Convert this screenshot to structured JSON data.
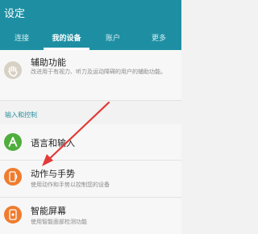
{
  "header": {
    "title": "设定"
  },
  "tabs": [
    {
      "label": "连接"
    },
    {
      "label": "我的设备"
    },
    {
      "label": "账户"
    },
    {
      "label": "更多"
    }
  ],
  "items": [
    {
      "title": "辅助功能",
      "subtitle": "改进用于有视力、听力及运动障碍的用户的辅助功能。",
      "icon": "accessibility-hand-icon",
      "color": "#d7d0c4"
    },
    {
      "title": "语言和输入",
      "subtitle": "",
      "icon": "language-a-icon",
      "color": "#4fae3d"
    },
    {
      "title": "动作与手势",
      "subtitle": "使用动作和手势以控制您的设备",
      "icon": "motion-gesture-icon",
      "color": "#ef7c2e"
    },
    {
      "title": "智能屏幕",
      "subtitle": "使用智能面部检测功能",
      "icon": "smart-screen-icon",
      "color": "#ef7c2e"
    }
  ],
  "section": {
    "label": "输入和控制"
  },
  "colors": {
    "appbar": "#1e8fa3",
    "accent": "#2a8fa0",
    "arrow": "#e23a37"
  }
}
